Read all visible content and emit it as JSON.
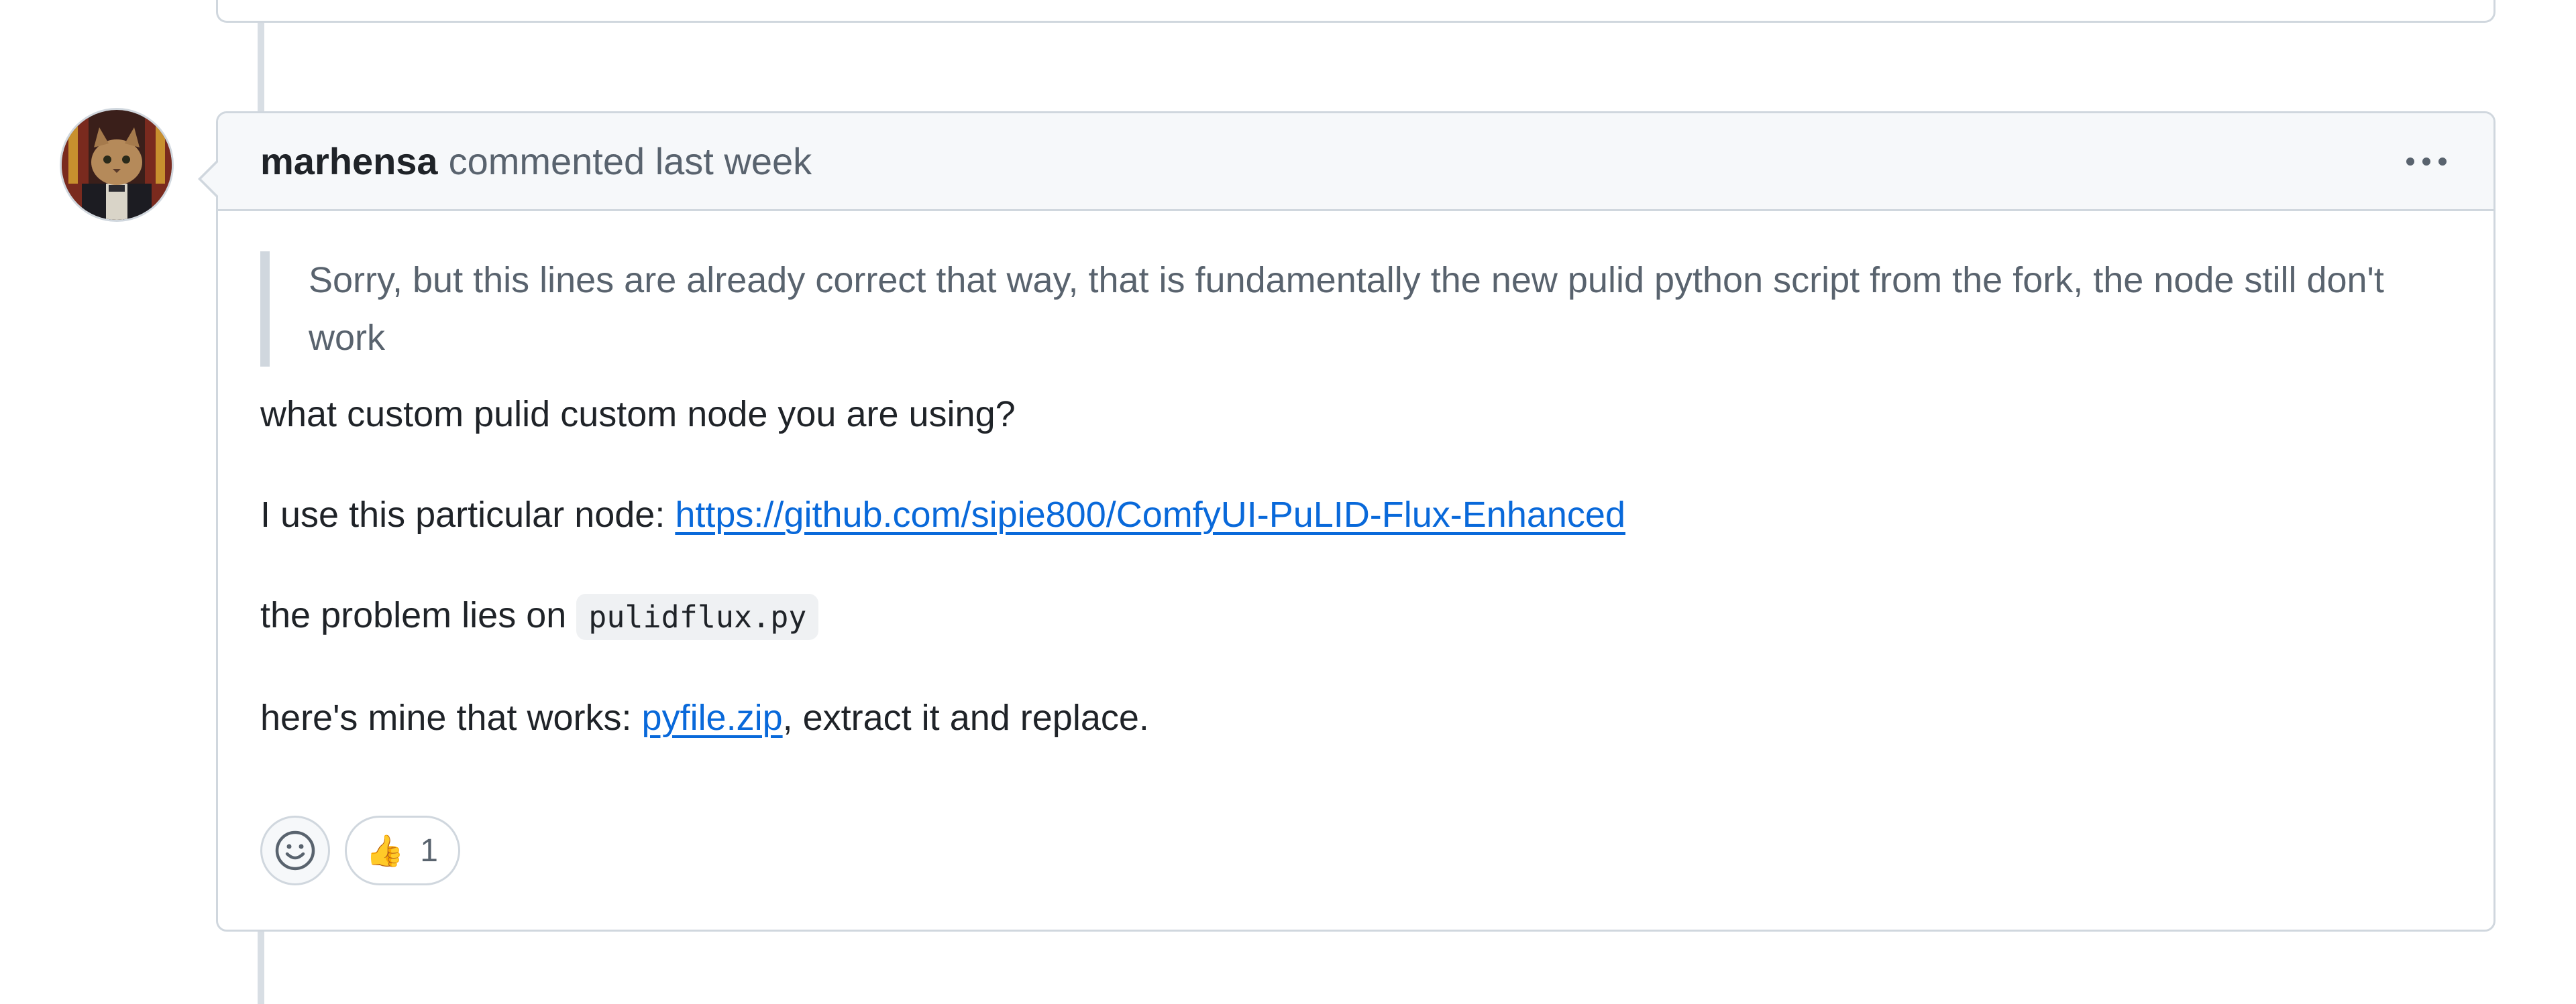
{
  "comment": {
    "author": "marhensa",
    "action": "commented last week",
    "quote": "Sorry, but this lines are already correct that way, that is fundamentally the new pulid python script from the fork, the node still don't work",
    "question": "what custom pulid custom node you are using?",
    "node_prefix": "I use this particular node: ",
    "node_link": "https://github.com/sipie800/ComfyUI-PuLID-Flux-Enhanced",
    "problem_prefix": "the problem lies on ",
    "problem_code": "pulidflux.py",
    "mine_prefix": "here's mine that works: ",
    "mine_link": "pyfile.zip",
    "mine_suffix": ", extract it and replace."
  },
  "reactions": {
    "add_icon": "smiley-icon",
    "thumbs_up_icon": "thumbs-up-icon",
    "thumbs_up_glyph": "👍",
    "thumbs_up_count": "1"
  },
  "menu_icon": "kebab-horizontal-icon"
}
